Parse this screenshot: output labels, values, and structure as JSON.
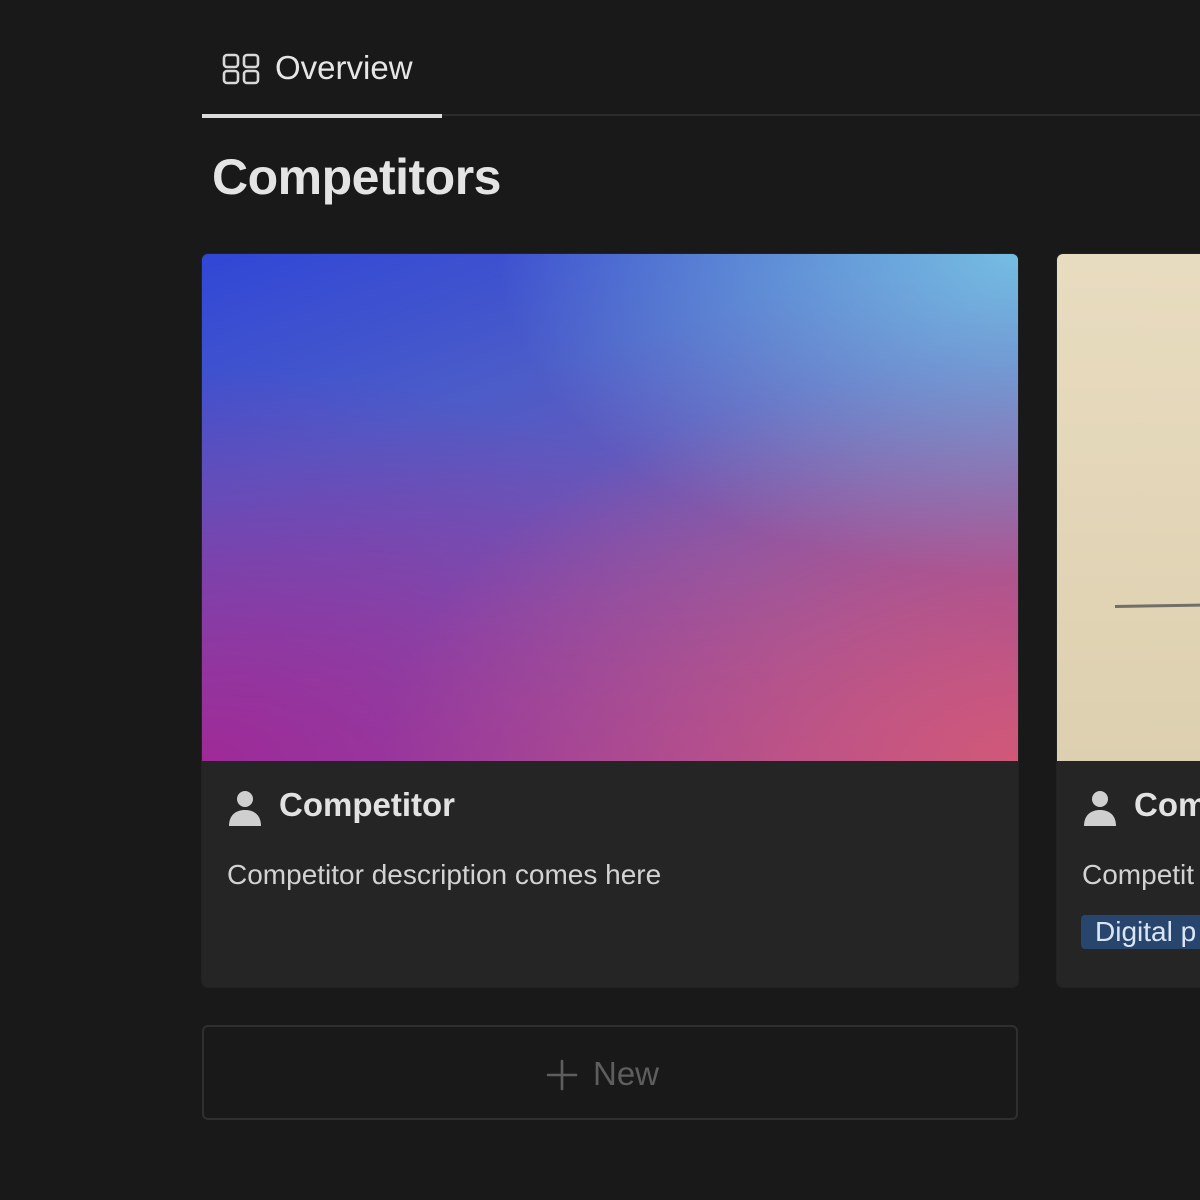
{
  "tabs": {
    "active": {
      "label": "Overview",
      "icon": "gallery-grid-icon"
    }
  },
  "page": {
    "title": "Competitors"
  },
  "cards": [
    {
      "title": "Competitor",
      "description": "Competitor description comes here",
      "icon": "person-icon",
      "cover": "gradient"
    },
    {
      "title": "Com",
      "description": "Competit",
      "tag": "Digital p",
      "icon": "person-icon",
      "cover": "paper"
    }
  ],
  "new_button": {
    "label": "New",
    "icon": "plus-icon"
  },
  "colors": {
    "background": "#191919",
    "card": "#252525",
    "tag_bg": "#28456e",
    "tab_underline": "#dcdcdc"
  }
}
